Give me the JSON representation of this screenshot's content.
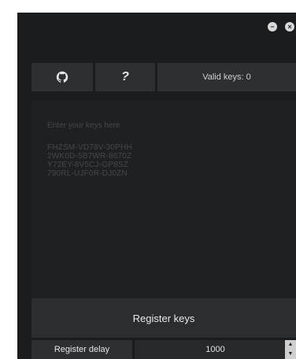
{
  "window": {
    "controls": [
      "minimize-icon",
      "close-icon"
    ]
  },
  "toolbar": {
    "github_icon": "github-icon",
    "help_icon": "help-icon",
    "valid_keys_label": "Valid keys: 0"
  },
  "keys": {
    "placeholder": "Enter your keys here",
    "lines": [
      "FHZSM-VD78V-30PHH",
      "2WK0D-5B7WR-8670Z",
      "Y72EY-8V5CJ-GP8SZ",
      "790RL-UJF0R-DJ0ZN"
    ]
  },
  "actions": {
    "register_label": "Register keys"
  },
  "delay": {
    "label": "Register delay",
    "value": "1000"
  },
  "colors": {
    "window_bg": "#1b1c1e",
    "button_bg": "#2d2f31",
    "text": "#e6e6e6",
    "muted_text": "#45474a"
  }
}
